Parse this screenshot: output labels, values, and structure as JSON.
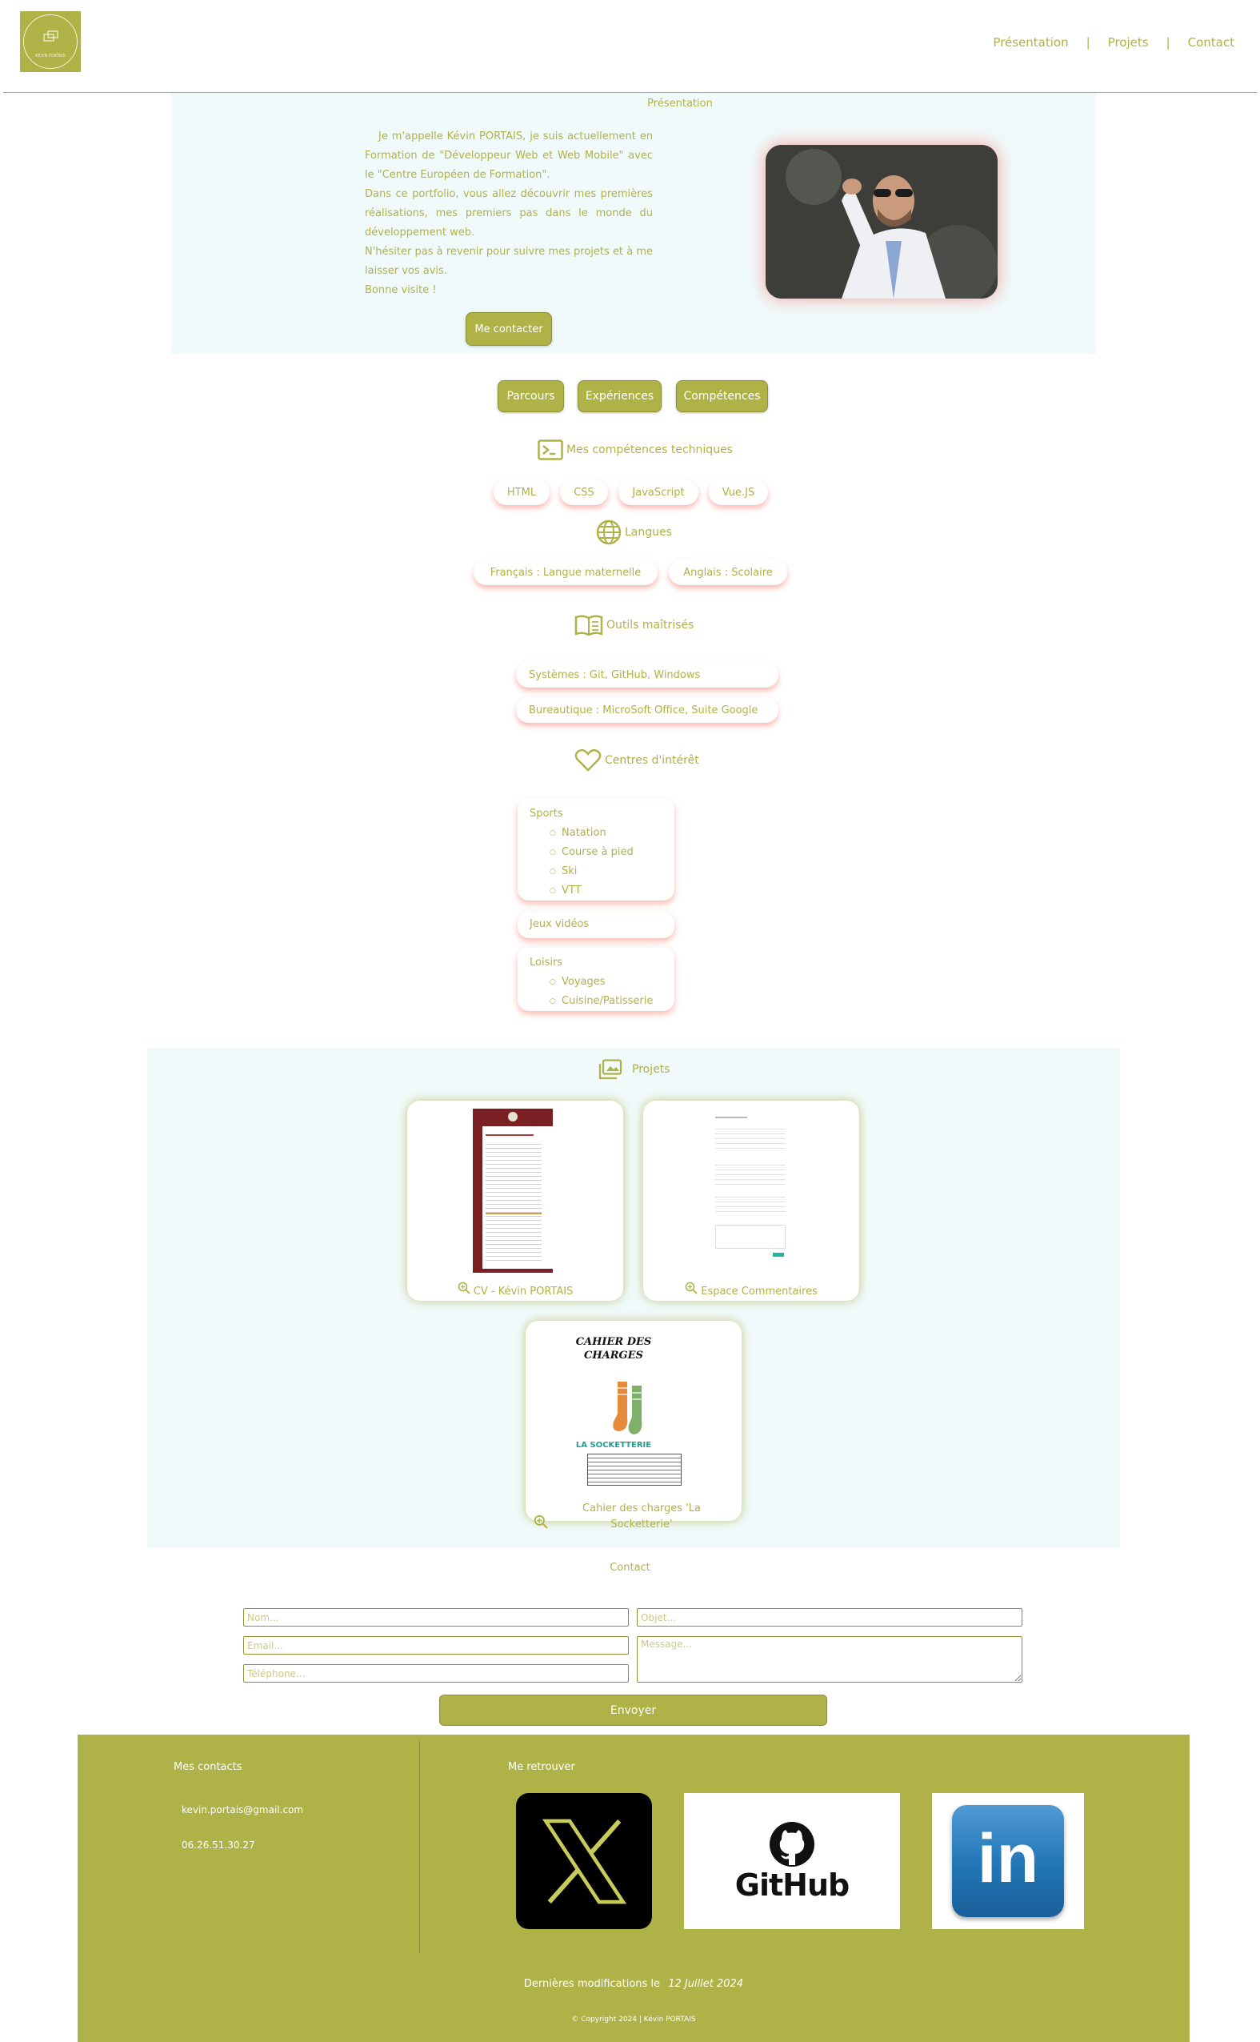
{
  "header": {
    "logo_text": "KEVIN PORTAIS",
    "nav": [
      {
        "label": "Présentation"
      },
      {
        "label": "Projets"
      },
      {
        "label": "Contact"
      }
    ],
    "separator": "|"
  },
  "presentation": {
    "title": "Présentation",
    "paragraphs": [
      "Je m'appelle Kévin PORTAIS, je suis actuellement en Formation de \"Développeur Web et Web Mobile\" avec le \"Centre Européen de Formation\".",
      "Dans ce portfolio, vous allez découvrir mes premières réalisations, mes premiers pas dans le monde du développement web.",
      "N'hésiter pas à revenir pour suivre mes projets et à me laisser vos avis.",
      "Bonne visite !"
    ],
    "contact_button": "Me contacter"
  },
  "tabs": [
    {
      "label": "Parcours"
    },
    {
      "label": "Expériences"
    },
    {
      "label": "Compétences"
    }
  ],
  "skills": {
    "tech_title": "Mes compétences techniques",
    "tech": [
      "HTML",
      "CSS",
      "JavaScript",
      "Vue.JS"
    ],
    "languages_title": "Langues",
    "languages": [
      "Français : Langue maternelle",
      "Anglais : Scolaire"
    ],
    "tools_title": "Outils maîtrisés",
    "tools": [
      "Systèmes : Git, GitHub, Windows",
      "Bureautique : MicroSoft Office, Suite Google"
    ],
    "interests_title": "Centres d'intérêt",
    "interests": {
      "sports_title": "Sports",
      "sports": [
        "Natation",
        "Course à pied",
        "Ski",
        "VTT"
      ],
      "games": "Jeux vidéos",
      "hobbies_title": "Loisirs",
      "hobbies": [
        "Voyages",
        "Cuisine/Patisserie"
      ]
    }
  },
  "projects": {
    "title": "Projets",
    "cards": [
      {
        "caption": "CV - Kévin PORTAIS"
      },
      {
        "caption": "Espace Commentaires"
      },
      {
        "caption": "Cahier des charges 'La Socketterie'",
        "cover_title": "CAHIER DES CHARGES",
        "cover_brand": "LA SOCKETTERIE"
      }
    ]
  },
  "contact": {
    "title": "Contact",
    "placeholders": {
      "name": "Nom...",
      "email": "Email...",
      "phone": "Téléphone...",
      "subject": "Objet...",
      "message": "Message..."
    },
    "send": "Envoyer"
  },
  "footer": {
    "contacts_title": "Mes contacts",
    "email": "kevin.portais@gmail.com",
    "phone": "06.26.51.30.27",
    "find_me_title": "Me retrouver",
    "github_label": "GitHub",
    "linkedin_label": "in",
    "last_modified_label": "Dernières modifications le",
    "last_modified_date": "12 Juillet 2024",
    "copyright": "© Copyright 2024 | Kévin PORTAIS"
  },
  "colors": {
    "accent": "#afb246",
    "light_bg": "#f0fafb",
    "shadow_pink": "#f48070",
    "linkedin_blue": "#2175b5"
  }
}
